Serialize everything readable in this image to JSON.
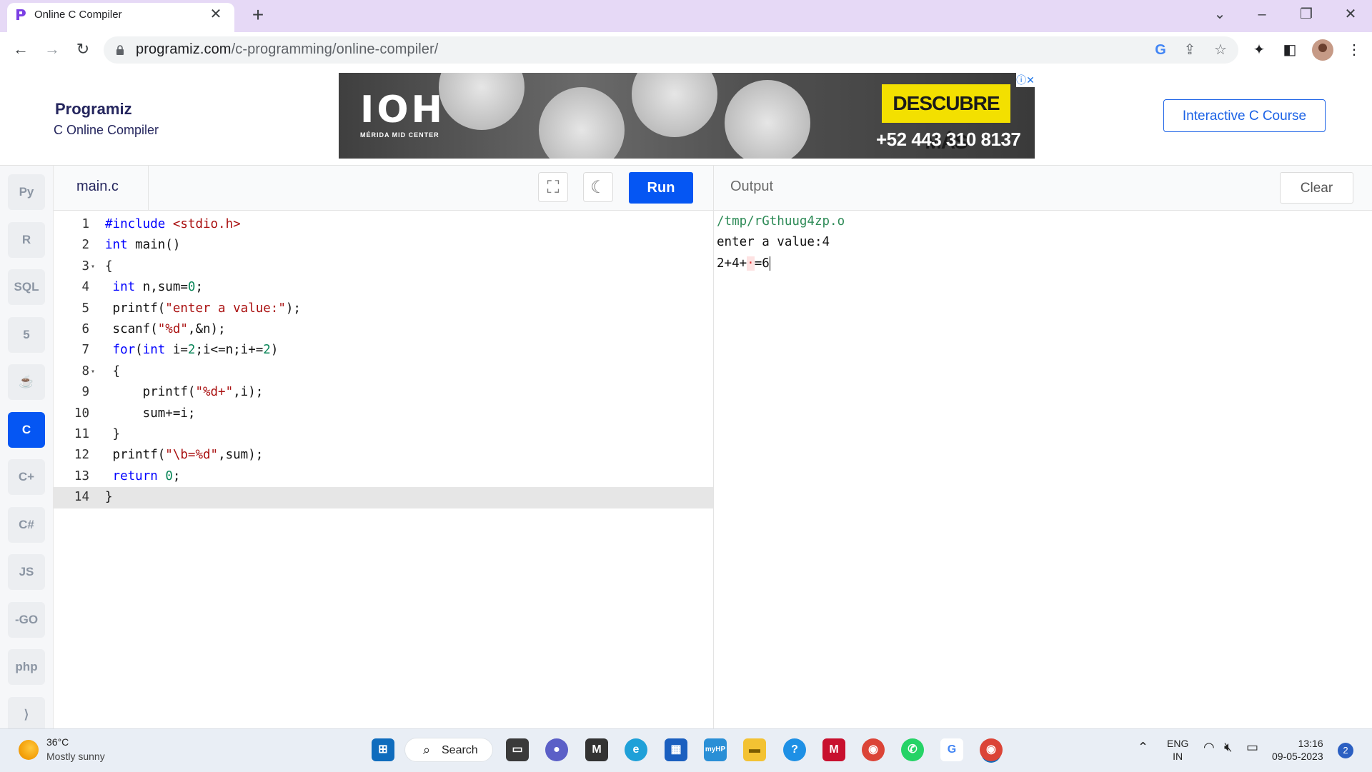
{
  "browser": {
    "tab_title": "Online C Compiler",
    "url_host": "programiz.com",
    "url_path": "/c-programming/online-compiler/"
  },
  "header": {
    "logo_text": "Programiz",
    "subtitle": "C Online Compiler",
    "course_button": "Interactive C Course"
  },
  "ad": {
    "brand": "IOH",
    "brand_sub": "MÉRIDA MID CENTER",
    "cta": "DESCUBRE MÁS",
    "phone": "+52 443 310 8137"
  },
  "sidebar": {
    "items": [
      {
        "name": "python",
        "label": "Py"
      },
      {
        "name": "r",
        "label": "R"
      },
      {
        "name": "sql",
        "label": "SQL"
      },
      {
        "name": "html",
        "label": "5"
      },
      {
        "name": "java",
        "label": "☕"
      },
      {
        "name": "c",
        "label": "C"
      },
      {
        "name": "cpp",
        "label": "C+"
      },
      {
        "name": "csharp",
        "label": "C#"
      },
      {
        "name": "js",
        "label": "JS"
      },
      {
        "name": "go",
        "label": "-GO"
      },
      {
        "name": "php",
        "label": "php"
      },
      {
        "name": "swift",
        "label": "⟩"
      }
    ],
    "active": "c"
  },
  "editor": {
    "filename": "main.c",
    "run_label": "Run",
    "lines": [
      {
        "n": "1",
        "html": "<span class='kw'>#include</span> <span class='inc'>&lt;stdio.h&gt;</span>"
      },
      {
        "n": "2",
        "html": "<span class='kw'>int</span> main()"
      },
      {
        "n": "3",
        "html": "{",
        "fold": true
      },
      {
        "n": "4",
        "html": " <span class='kw'>int</span> n,sum=<span class='num'>0</span>;"
      },
      {
        "n": "5",
        "html": " printf(<span class='str'>\"enter a value:\"</span>);"
      },
      {
        "n": "6",
        "html": " scanf(<span class='str'>\"%d\"</span>,&amp;n);"
      },
      {
        "n": "7",
        "html": " <span class='kw'>for</span>(<span class='kw'>int</span> i=<span class='num'>2</span>;i&lt;=n;i+=<span class='num'>2</span>)"
      },
      {
        "n": "8",
        "html": " {",
        "fold": true
      },
      {
        "n": "9",
        "html": "     printf(<span class='str'>\"%d+\"</span>,i);"
      },
      {
        "n": "10",
        "html": "     sum+=i;"
      },
      {
        "n": "11",
        "html": " }"
      },
      {
        "n": "12",
        "html": " printf(<span class='str'>\"\\b=%d\"</span>,sum);"
      },
      {
        "n": "13",
        "html": " <span class='kw'>return</span> <span class='num'>0</span>;"
      },
      {
        "n": "14",
        "html": "}",
        "active": true
      }
    ]
  },
  "output": {
    "title": "Output",
    "clear_label": "Clear",
    "lines": [
      "/tmp/rGthuug4zp.o",
      "enter a value:4",
      "2+4+\b=6"
    ]
  },
  "taskbar": {
    "temp": "36°C",
    "weather": "Mostly sunny",
    "search": "Search",
    "lang_top": "ENG",
    "lang_bottom": "IN",
    "time": "13:16",
    "date": "09-05-2023",
    "notifications": "2"
  }
}
